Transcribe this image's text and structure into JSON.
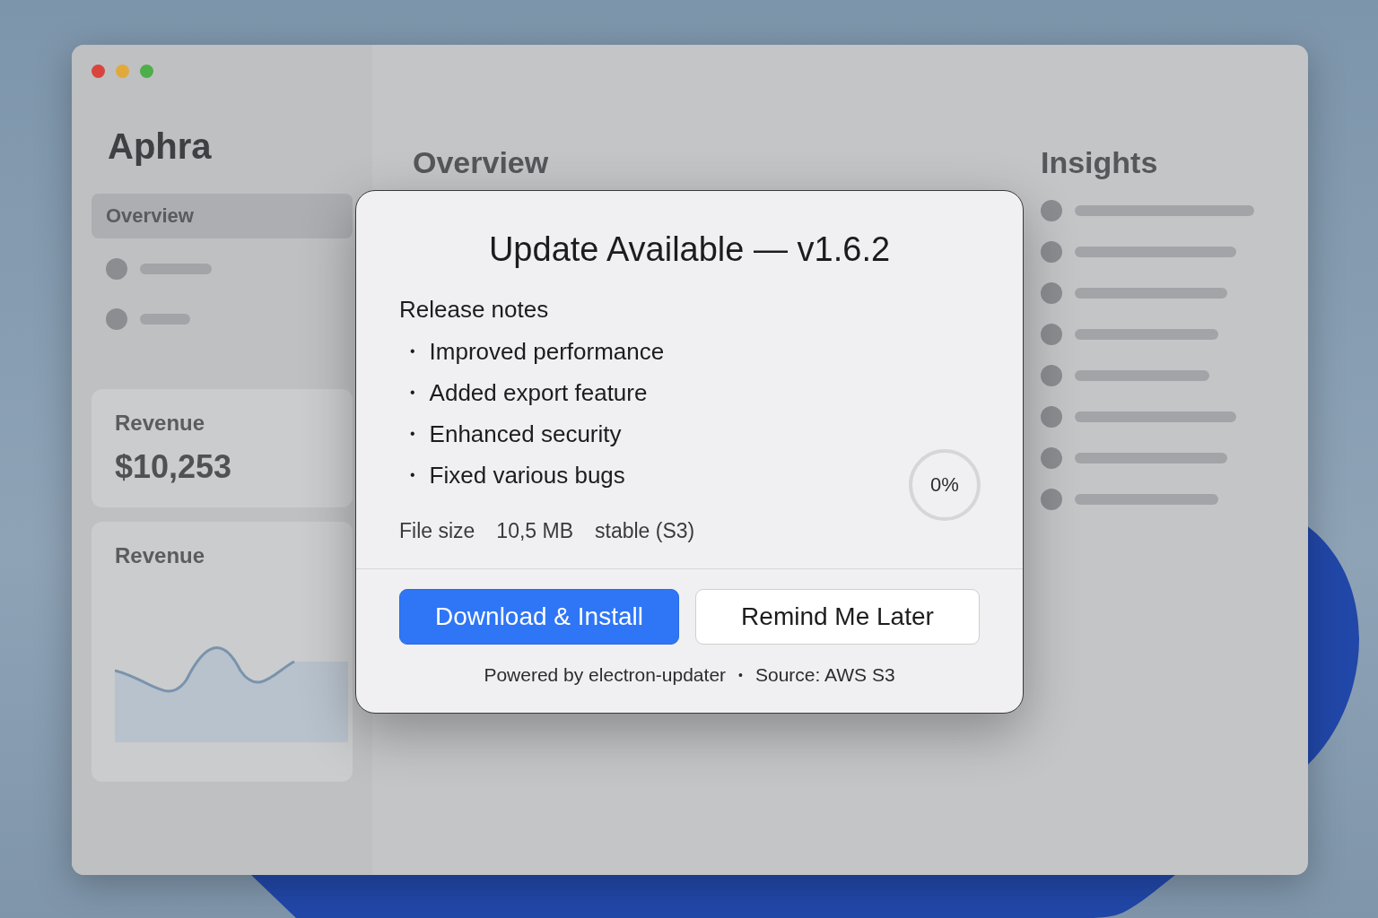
{
  "app": {
    "title": "Aphra",
    "nav": [
      {
        "label": "Overview",
        "selected": true
      }
    ],
    "overview": {
      "heading": "Overview",
      "stat_card": {
        "title": "Revenue",
        "value": "$10,253"
      },
      "chart_card": {
        "title": "Revenue"
      }
    },
    "insights": {
      "heading": "Insights"
    }
  },
  "dialog": {
    "title": "Update Available — v1.6.2",
    "notes_heading": "Release notes",
    "bullet": "•",
    "notes": [
      "Improved performance",
      "Added export feature",
      "Enhanced security",
      "Fixed various bugs"
    ],
    "file_size_label": "File size",
    "file_size": "10,5 MB",
    "channel": "stable (S3)",
    "progress": {
      "reading": "0%"
    },
    "buttons": [
      {
        "label": "Download & Install",
        "kind": "primary"
      },
      {
        "label": "Remind Me Later",
        "kind": "secondary"
      }
    ],
    "footer": [
      "Powered by electron-updater",
      "Source: AWS S3"
    ],
    "footer_separator": "•"
  }
}
